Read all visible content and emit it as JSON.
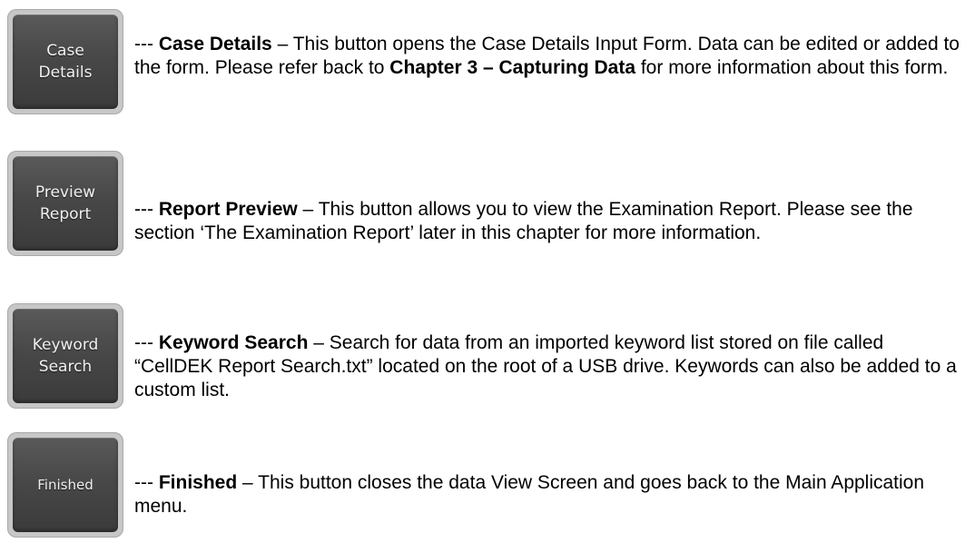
{
  "items": [
    {
      "button_label": "Case\nDetails",
      "prefix": "--- ",
      "title": "Case Details",
      "text1": " – This button opens the Case Details Input Form. Data can be edited or added to the form. Please refer back to ",
      "ref": "Chapter 3 – Capturing Data",
      "text2": " for more information about this form."
    },
    {
      "button_label": "Preview\nReport",
      "prefix": "--- ",
      "title": "Report Preview",
      "text1": " – This button allows you to view the Examination Report. Please see the section ‘The Examination Report’ later in this chapter for more information."
    },
    {
      "button_label": "Keyword\nSearch",
      "prefix": "--- ",
      "title": "Keyword Search",
      "text1": " – Search for data from an imported keyword list stored on file called “CellDEK Report Search.txt” located on the root of a USB drive. Keywords can also be added to a custom list."
    },
    {
      "button_label": "Finished",
      "prefix": "--- ",
      "title": "Finished",
      "text1": " – This button closes the data View Screen and goes back to the Main Application menu."
    }
  ]
}
